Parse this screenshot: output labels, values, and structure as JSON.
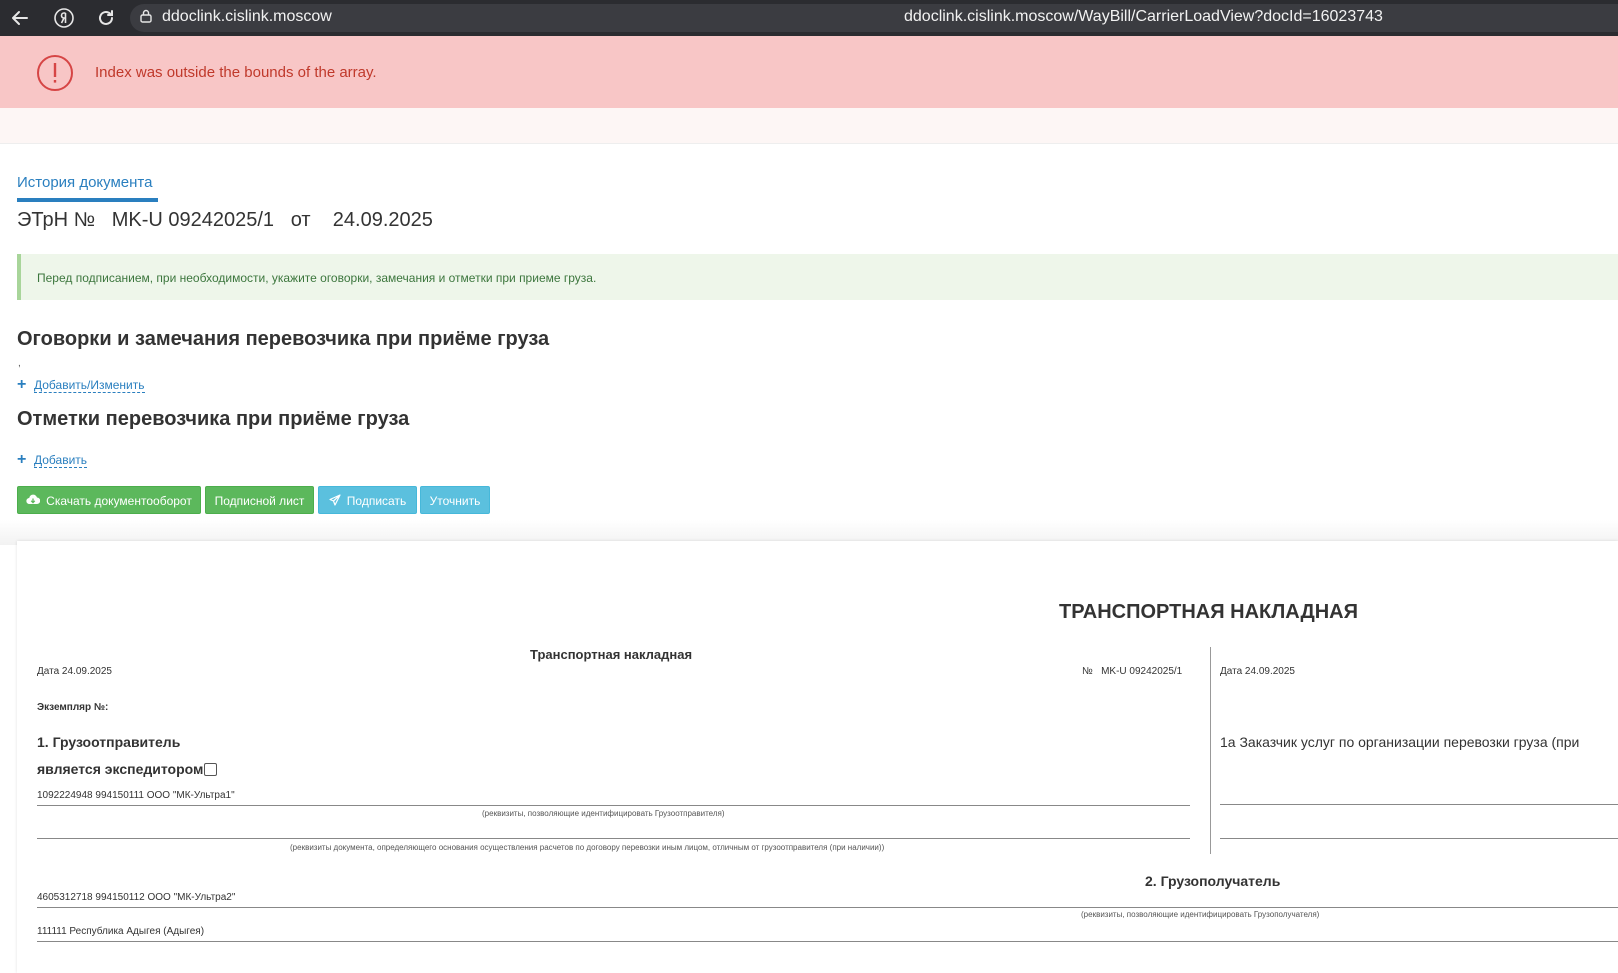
{
  "browser": {
    "host": "ddoclink.cislink.moscow",
    "url": "ddoclink.cislink.moscow/WayBill/CarrierLoadView?docId=16023743",
    "icons": [
      "back-arrow-icon",
      "yandex-icon",
      "reload-icon",
      "lock-icon"
    ]
  },
  "error": {
    "message": "Index was outside the bounds of the array.",
    "color": "#c0392b"
  },
  "tabs": {
    "history": "История документа"
  },
  "document_header": {
    "title": "ЭТрН №   MK-U 09242025/1   от    24.09.2025"
  },
  "info": {
    "text": "Перед подписанием, при необходимости, укажите оговорки, замечания и отметки при приеме груза."
  },
  "sections": {
    "reservations_title": "Оговорки и замечания перевозчика при приёме груза",
    "reservations_value": ",",
    "reservations_link": "Добавить/Изменить",
    "marks_title": "Отметки перевозчика при приёме груза",
    "marks_link": "Добавить"
  },
  "actions": {
    "download": "Скачать документооборот",
    "sign_list": "Подписной лист",
    "sign": "Подписать",
    "clarify": "Уточнить",
    "colors": {
      "green": "#5cb85c",
      "blue": "#5bc0de"
    }
  },
  "waybill": {
    "main_title": "ТРАНСПОРТНАЯ НАКЛАДНАЯ",
    "sub_title": "Транспортная накладная",
    "date_left": "Дата  24.09.2025",
    "number_left": "№   MK-U 09242025/1",
    "date_right": "Дата 24.09.2025",
    "copy_label": "Экземпляр №:",
    "shipper_title": "1. Грузоотправитель",
    "expeditor_label": "является экспедитором",
    "shipper_value": "1092224948 994150111 ООО \"МК-Ультра1\"",
    "shipper_caption": "(реквизиты, позволяющие идентифицировать Грузоотправителя)",
    "doc_caption": "(реквизиты документа, определяющего основания осуществления расчетов по договору перевозки иным лицом, отличным от грузоотправителя (при наличии))",
    "customer_label": "1а Заказчик услуг по организации перевозки груза (при",
    "consignee_title": "2. Грузополучатель",
    "consignee_value": "4605312718 994150112 ООО \"МК-Ультра2\"",
    "consignee_caption": "(реквизиты, позволяющие идентифицировать Грузополучателя)",
    "address_value": "111111 Республика Адыгея (Адыгея)"
  }
}
